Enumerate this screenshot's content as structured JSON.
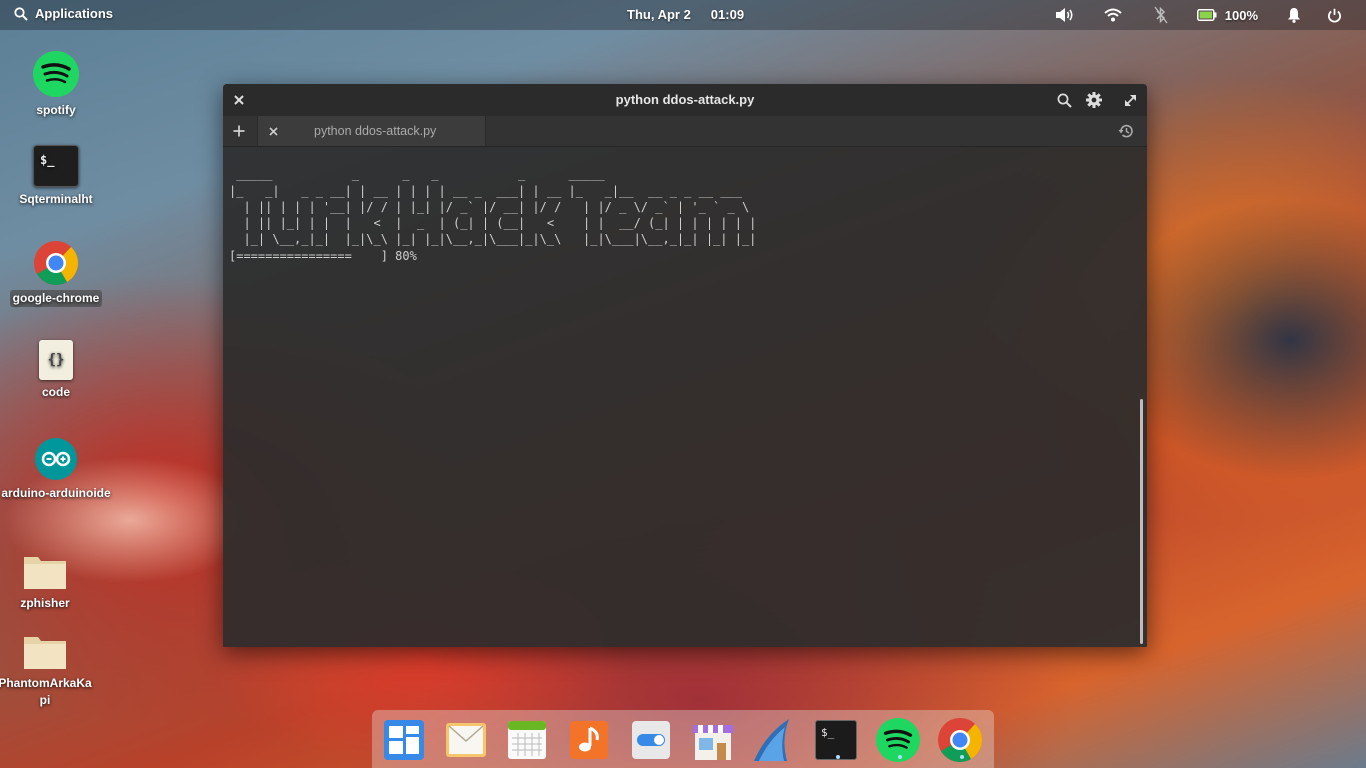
{
  "top_panel": {
    "applications_label": "Applications",
    "date": "Thu, Apr 2",
    "time": "01:09",
    "battery_percent": "100%"
  },
  "desktop_icons": [
    {
      "label": "spotify"
    },
    {
      "label": "Sqterminalht"
    },
    {
      "label": "google-chrome"
    },
    {
      "label": "code",
      "glyph": "{}"
    },
    {
      "label": "arduino-arduinoide"
    },
    {
      "label": "zphisher"
    },
    {
      "label": "PhantomArkaKapi"
    }
  ],
  "terminal": {
    "window_title": "python ddos-attack.py",
    "tab_title": "python ddos-attack.py",
    "prompt_glyph": "$_",
    "output_lines": [
      " _____           _      _   _           _      _____",
      "|_   _|   _ _ __| | __ | | | | __ _  ___| | __ |_   _|__  __ _ _ __ ___",
      "  | || | | | '__| |/ / | |_| |/ _` |/ __| |/ /   | |/ _ \\/ _` | '_ ` _ \\",
      "  | || |_| | |  |   <  |  _  | (_| | (__|   <    | |  __/ (_| | | | | | |",
      "  |_| \\__,_|_|  |_|\\_\\ |_| |_|\\__,_|\\___|_|\\_\\   |_|\\___|\\__,_|_| |_| |_|",
      "",
      "[================    ] 80%"
    ]
  },
  "colors": {
    "spotify_green": "#1ed760",
    "arduino_teal": "#00979c",
    "accent_blue": "#3689e6"
  }
}
